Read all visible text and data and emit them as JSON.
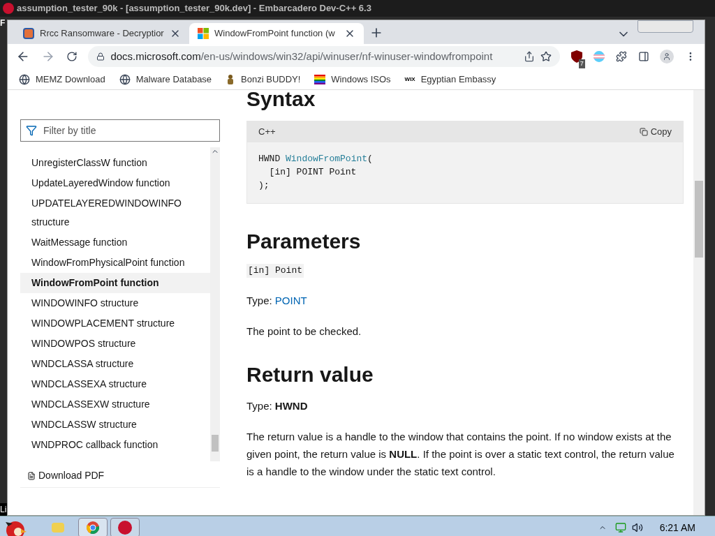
{
  "outer_window": {
    "title": "assumption_tester_90k - [assumption_tester_90k.dev] - Embarcadero Dev-C++ 6.3",
    "edge_texts": [
      "F",
      "Li"
    ]
  },
  "tabs": [
    {
      "title": "Rrcc Ransomware - Decryptior",
      "selected": false
    },
    {
      "title": "WindowFromPoint function (w",
      "selected": true
    }
  ],
  "address_bar": {
    "host": "docs.microsoft.com",
    "path": "/en-us/windows/win32/api/winuser/nf-winuser-windowfrompoint"
  },
  "extension_badge": "7",
  "bookmarks": [
    {
      "label": "MEMZ Download",
      "kind": "globe"
    },
    {
      "label": "Malware Database",
      "kind": "globe"
    },
    {
      "label": "Bonzi BUDDY!",
      "kind": "figure"
    },
    {
      "label": "Windows ISOs",
      "kind": "rainbow"
    },
    {
      "label": "Egyptian Embassy",
      "kind": "wix",
      "icon_text": "WIX"
    }
  ],
  "sidebar": {
    "filter_placeholder": "Filter by title",
    "items": [
      {
        "label": "UnregisterClassW function",
        "selected": false
      },
      {
        "label": "UpdateLayeredWindow function",
        "selected": false
      },
      {
        "label": "UPDATELAYEREDWINDOWINFO structure",
        "selected": false
      },
      {
        "label": "WaitMessage function",
        "selected": false
      },
      {
        "label": "WindowFromPhysicalPoint function",
        "selected": false
      },
      {
        "label": "WindowFromPoint function",
        "selected": true
      },
      {
        "label": "WINDOWINFO structure",
        "selected": false
      },
      {
        "label": "WINDOWPLACEMENT structure",
        "selected": false
      },
      {
        "label": "WINDOWPOS structure",
        "selected": false
      },
      {
        "label": "WNDCLASSA structure",
        "selected": false
      },
      {
        "label": "WNDCLASSEXA structure",
        "selected": false
      },
      {
        "label": "WNDCLASSEXW structure",
        "selected": false
      },
      {
        "label": "WNDCLASSW structure",
        "selected": false
      },
      {
        "label": "WNDPROC callback function",
        "selected": false
      }
    ],
    "download": "Download PDF"
  },
  "article": {
    "syntax_heading": "Syntax",
    "code": {
      "language": "C++",
      "copy": "Copy",
      "lines": [
        {
          "plain": "HWND ",
          "highlight": "WindowFromPoint",
          "rest": "("
        },
        {
          "plain": "  [in] POINT Point"
        },
        {
          "plain": ");"
        }
      ]
    },
    "parameters_heading": "Parameters",
    "param_name": "[in] Point",
    "param_type_label": "Type: ",
    "param_type": "POINT",
    "param_desc": "The point to be checked.",
    "return_heading": "Return value",
    "return_type_label": "Type: ",
    "return_type": "HWND",
    "return_desc": "The return value is a handle to the window that contains the point. If no window exists at the given point, the return value is **NULL**. If the point is over a static text control, the return value is a handle to the window under the static text control."
  },
  "taskbar": {
    "clock": "6:21 AM"
  }
}
